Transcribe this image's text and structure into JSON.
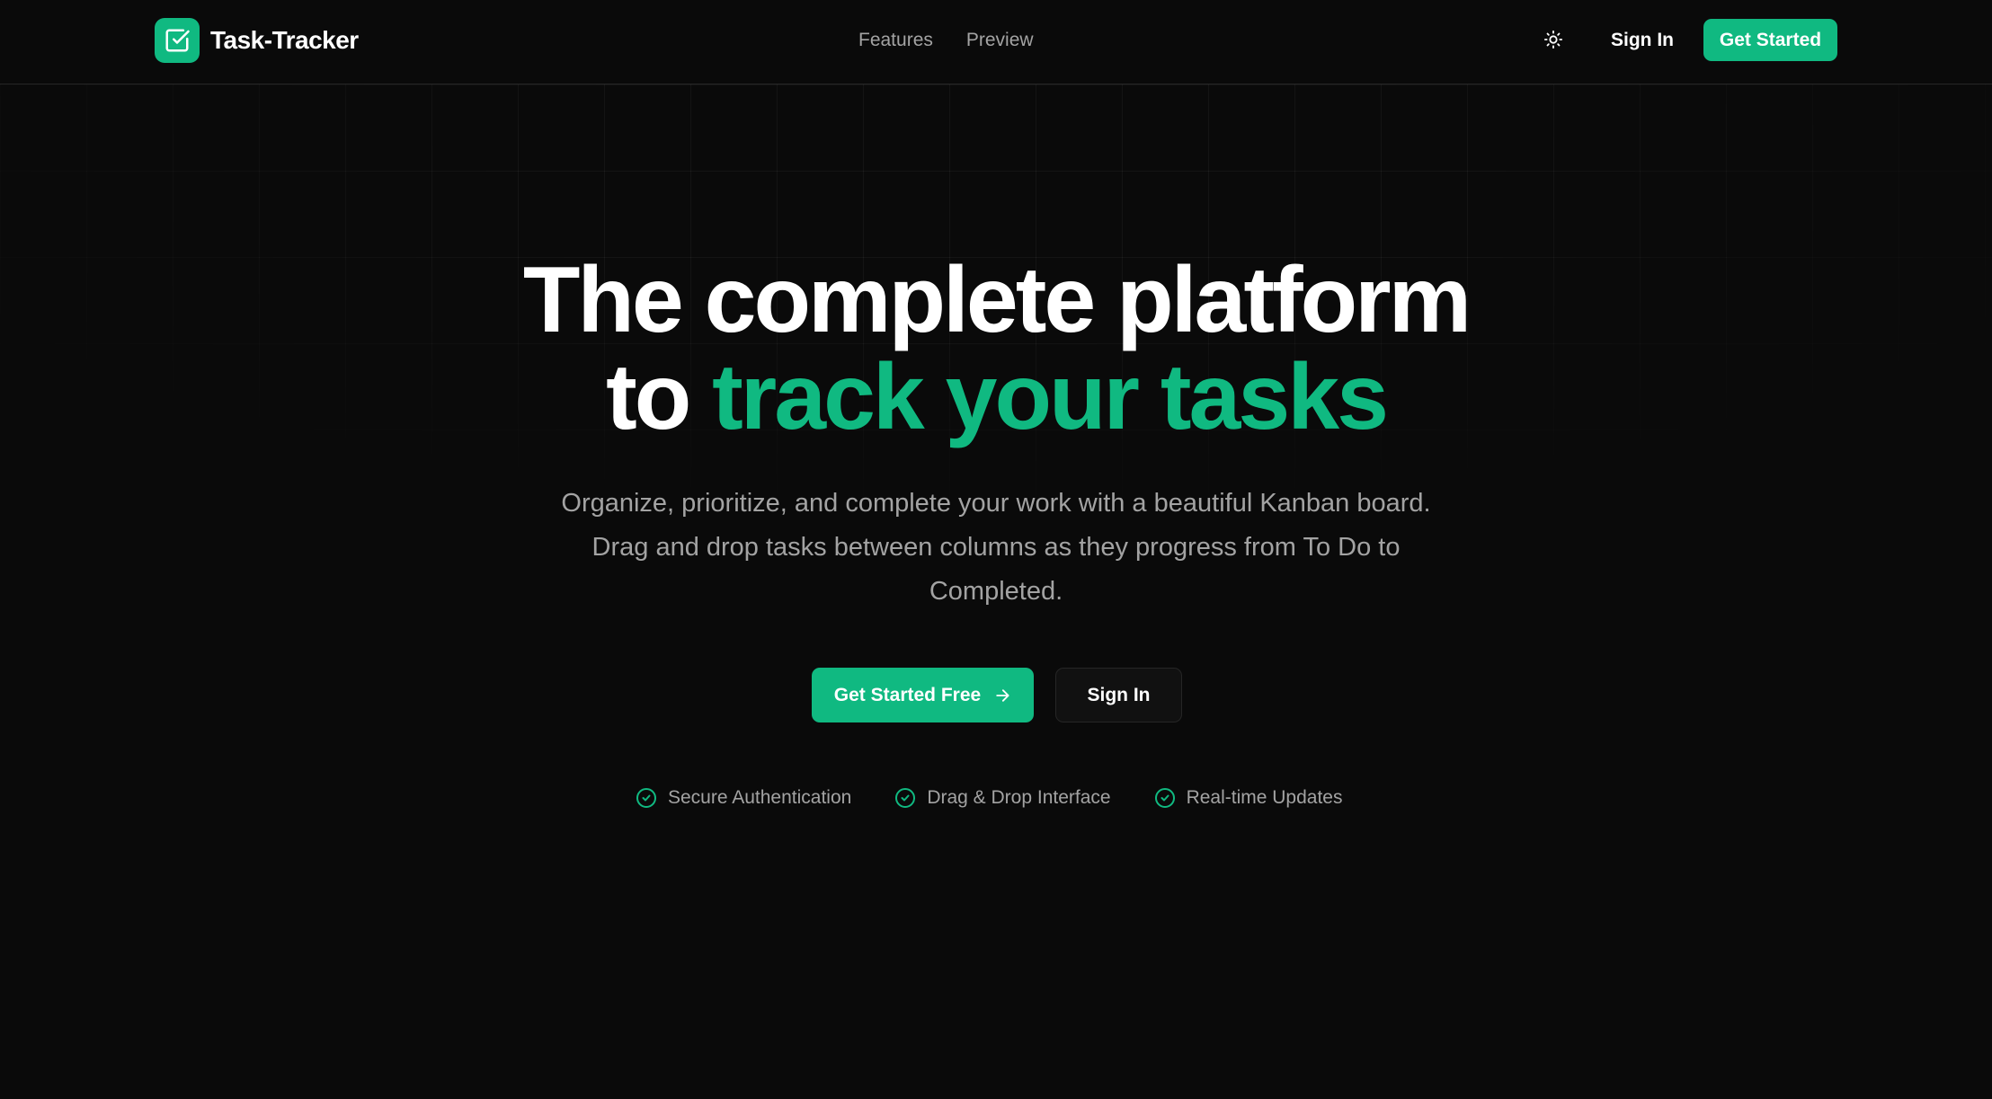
{
  "app": {
    "name": "Task-Tracker",
    "accent_color": "#10b981",
    "background_color": "#0a0a0a",
    "logo_icon": "square-check-icon"
  },
  "header": {
    "nav": [
      {
        "label": "Features"
      },
      {
        "label": "Preview"
      }
    ],
    "theme_toggle_icon": "sun-icon",
    "sign_in_label": "Sign In",
    "cta_label": "Get Started"
  },
  "hero": {
    "title_line1": "The complete platform",
    "title_line2_prefix": "to ",
    "title_line2_accent": "track your tasks",
    "subtitle": "Organize, prioritize, and complete your work with a beautiful Kanban board. Drag and drop tasks between columns as they progress from To Do to Completed.",
    "primary_cta": {
      "label": "Get Started Free",
      "icon": "arrow-right-icon"
    },
    "secondary_cta": {
      "label": "Sign In"
    },
    "features": [
      {
        "label": "Secure Authentication",
        "icon": "circle-check-icon"
      },
      {
        "label": "Drag & Drop Interface",
        "icon": "circle-check-icon"
      },
      {
        "label": "Real-time Updates",
        "icon": "circle-check-icon"
      }
    ]
  }
}
